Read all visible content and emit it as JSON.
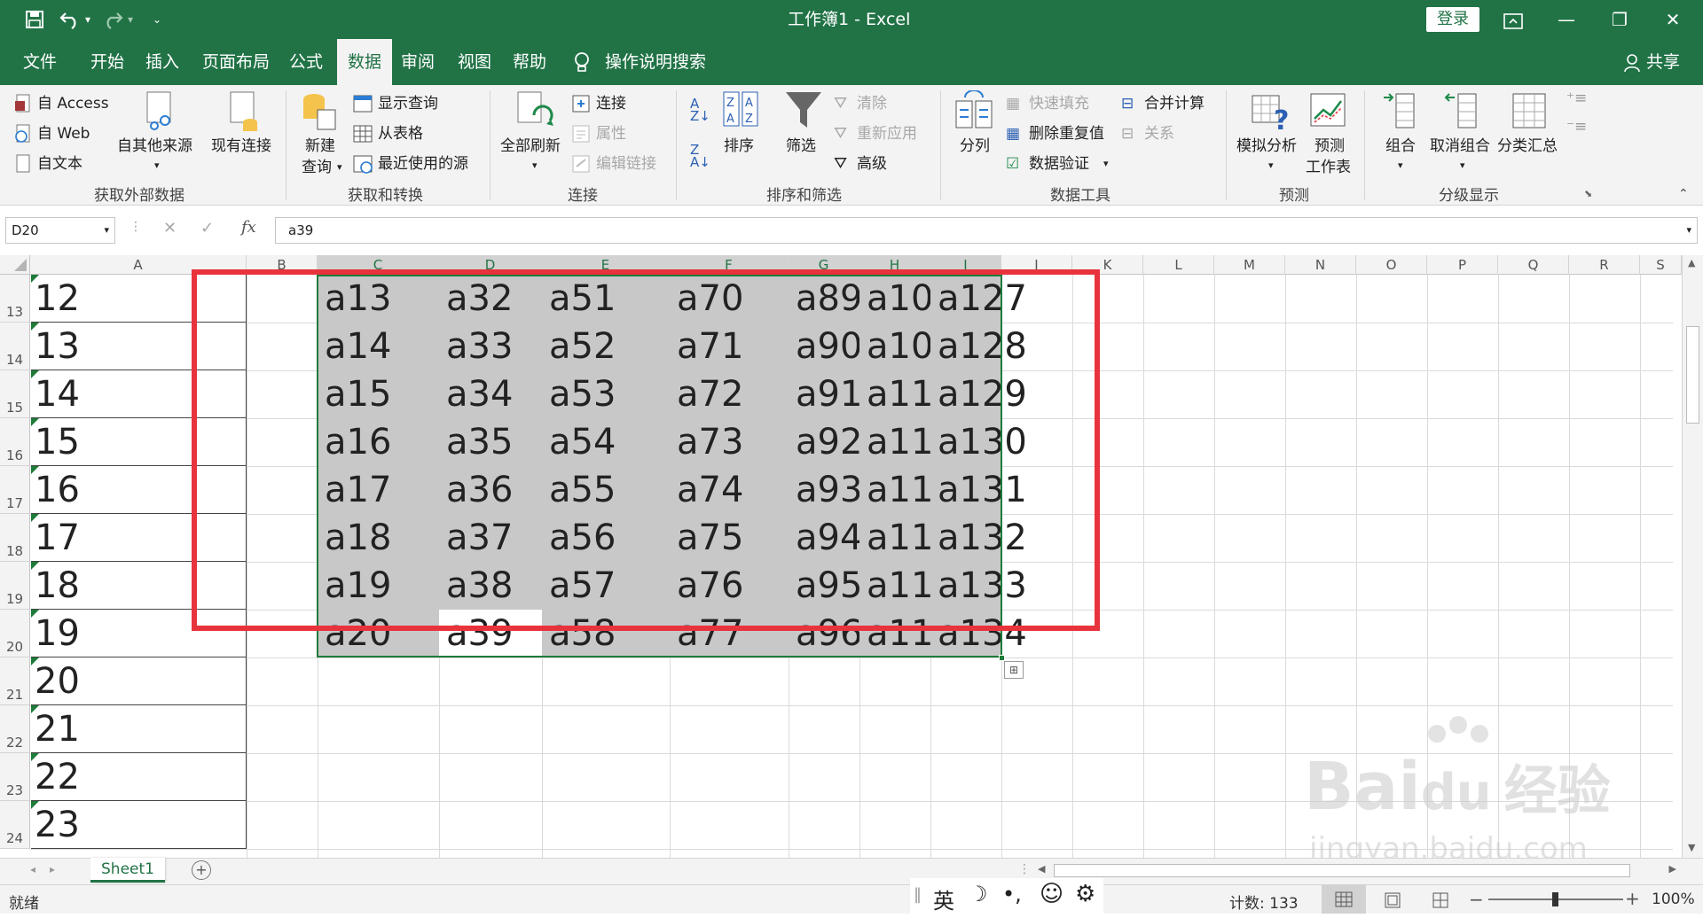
{
  "window": {
    "title": "工作簿1 - Excel",
    "login": "登录"
  },
  "menu": [
    "文件",
    "开始",
    "插入",
    "页面布局",
    "公式",
    "数据",
    "审阅",
    "视图",
    "帮助"
  ],
  "menu_search": "操作说明搜索",
  "share": "共享",
  "ribbon": {
    "get_external": {
      "items": [
        "自 Access",
        "自 Web",
        "自文本"
      ],
      "other_sources": "自其他来源",
      "existing": "现有连接",
      "label": "获取外部数据"
    },
    "get_transform": {
      "new_query_1": "新建",
      "new_query_2": "查询",
      "items": [
        "显示查询",
        "从表格",
        "最近使用的源"
      ],
      "label": "获取和转换"
    },
    "connections": {
      "refresh_all": "全部刷新",
      "items": [
        "连接",
        "属性",
        "编辑链接"
      ],
      "label": "连接"
    },
    "sort_filter": {
      "sort": "排序",
      "filter": "筛选",
      "items": [
        "清除",
        "重新应用",
        "高级"
      ],
      "label": "排序和筛选"
    },
    "data_tools": {
      "split": "分列",
      "items": [
        "快速填充",
        "删除重复值",
        "数据验证"
      ],
      "items2": [
        "合并计算",
        "关系"
      ],
      "label": "数据工具"
    },
    "forecast": {
      "whatif": "模拟分析",
      "sheet_1": "预测",
      "sheet_2": "工作表",
      "label": "预测"
    },
    "outline": {
      "items": [
        "组合",
        "取消组合",
        "分类汇总"
      ],
      "label": "分级显示"
    }
  },
  "formula_bar": {
    "name_box": "D20",
    "cancel": "✕",
    "enter": "✓",
    "fx": "fx",
    "value": "a39"
  },
  "columns": [
    "A",
    "B",
    "C",
    "D",
    "E",
    "F",
    "G",
    "H",
    "I",
    "J",
    "K",
    "L",
    "M",
    "N",
    "O",
    "P",
    "Q",
    "R",
    "S"
  ],
  "rows": [
    "13",
    "14",
    "15",
    "16",
    "17",
    "18",
    "19",
    "20",
    "21",
    "22",
    "23",
    "24"
  ],
  "col_a_values": [
    "12",
    "13",
    "14",
    "15",
    "16",
    "17",
    "18",
    "19",
    "20",
    "21",
    "22",
    "23"
  ],
  "table": [
    [
      "a13",
      "a32",
      "a51",
      "a70",
      "a89",
      "a10",
      "a127"
    ],
    [
      "a14",
      "a33",
      "a52",
      "a71",
      "a90",
      "a10",
      "a128"
    ],
    [
      "a15",
      "a34",
      "a53",
      "a72",
      "a91",
      "a11",
      "a129"
    ],
    [
      "a16",
      "a35",
      "a54",
      "a73",
      "a92",
      "a11",
      "a130"
    ],
    [
      "a17",
      "a36",
      "a55",
      "a74",
      "a93",
      "a11",
      "a131"
    ],
    [
      "a18",
      "a37",
      "a56",
      "a75",
      "a94",
      "a11",
      "a132"
    ],
    [
      "a19",
      "a38",
      "a57",
      "a76",
      "a95",
      "a11",
      "a133"
    ],
    [
      "a20",
      "a39",
      "a58",
      "a77",
      "a96",
      "a11",
      "a134"
    ]
  ],
  "sheet_tab": "Sheet1",
  "status": {
    "ready": "就绪",
    "ime": "英",
    "count": "计数: 133",
    "zoom": "100%"
  },
  "watermark": {
    "logo": "Bai",
    "logo_suffix": "du",
    "logo_cn": "经验",
    "url": "jingyan.baidu.com"
  },
  "colors": {
    "excel_green": "#217346",
    "highlight_red": "#e8333c",
    "selection_gray": "#c8c8c8"
  }
}
